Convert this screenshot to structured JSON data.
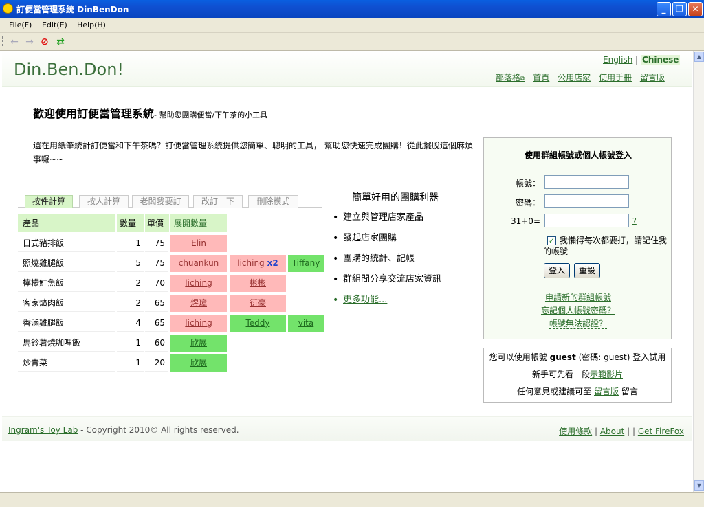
{
  "window": {
    "title": "訂便當管理系統 DinBenDon",
    "minimize": "_",
    "maximize": "❐",
    "close": "✕"
  },
  "menu": [
    "File(F)",
    "Edit(E)",
    "Help(H)"
  ],
  "toolbar": {
    "back_icon": "←",
    "forward_icon": "→",
    "stop_icon": "⊘",
    "refresh_icon": "⇄"
  },
  "header": {
    "logo": "Din.Ben.Don!",
    "lang_english": "English",
    "lang_sep": " | ",
    "lang_chinese": "Chinese",
    "nav": [
      "部落格",
      "首頁",
      "公用店家",
      "使用手冊",
      "留言版"
    ]
  },
  "welcome": {
    "title": "歡迎使用訂便當管理系統",
    "subtitle": "- 幫助您團購便當/下午茶的小工具"
  },
  "intro": "還在用紙筆統計訂便當和下午茶嗎？訂便當管理系統提供您簡單、聰明的工具， 幫助您快速完成團購！從此擺脫這個麻煩事囉~~",
  "tabs": [
    "按件計算",
    "按人計算",
    "老闆我要訂",
    "改訂一下",
    "刪除模式"
  ],
  "table": {
    "headers": {
      "product": "產品",
      "qty": "數量",
      "price": "單價",
      "expand": "展開數量"
    },
    "rows": [
      {
        "product": "日式豬排飯",
        "qty": "1",
        "price": "75",
        "chips": [
          {
            "name": "Elin",
            "color": "red"
          }
        ]
      },
      {
        "product": "照燒雞腿飯",
        "qty": "5",
        "price": "75",
        "chips": [
          {
            "name": "chuankun",
            "color": "red"
          },
          {
            "name": "liching",
            "mult": "x2",
            "color": "red"
          },
          {
            "name": "Tiffany",
            "color": "green"
          }
        ]
      },
      {
        "product": "檸檬鮭魚飯",
        "qty": "2",
        "price": "70",
        "chips": [
          {
            "name": "liching",
            "color": "red"
          },
          {
            "name": "彬彬",
            "color": "red"
          }
        ]
      },
      {
        "product": "客家爌肉飯",
        "qty": "2",
        "price": "65",
        "chips": [
          {
            "name": "煜璋",
            "color": "red"
          },
          {
            "name": "衍豪",
            "color": "red"
          }
        ]
      },
      {
        "product": "香滷雞腿飯",
        "qty": "4",
        "price": "65",
        "chips": [
          {
            "name": "liching",
            "color": "red"
          },
          {
            "name": "Teddy",
            "color": "green"
          },
          {
            "name": "vita",
            "color": "green"
          }
        ]
      },
      {
        "product": "馬鈴薯燒咖哩飯",
        "qty": "1",
        "price": "60",
        "chips": [
          {
            "name": "欣展",
            "color": "green"
          }
        ]
      },
      {
        "product": "炒青菜",
        "qty": "1",
        "price": "20",
        "chips": [
          {
            "name": "欣展",
            "color": "green"
          }
        ]
      }
    ]
  },
  "features": {
    "title": "簡單好用的團購利器",
    "items": [
      "建立與管理店家產品",
      "發起店家團購",
      "團購的統計、記帳",
      "群組間分享交流店家資訊"
    ],
    "more": "更多功能..."
  },
  "login": {
    "title": "使用群組帳號或個人帳號登入",
    "account_label": "帳號：",
    "password_label": "密碼：",
    "captcha_label": "31+0=",
    "captcha_help": "?",
    "remember": "我懶得每次都要打，請記住我的帳號",
    "login_button": "登入",
    "reset_button": "重設",
    "links": [
      "申請新的群組帳號",
      "忘記個人帳號密碼？",
      "帳號無法認證？"
    ]
  },
  "guest": {
    "line1_pre": "您可以使用帳號 ",
    "line1_user": "guest",
    "line1_post": " (密碼: guest) 登入試用",
    "line2_pre": "新手可先看一段",
    "line2_link": "示範影片",
    "line3_pre": "任何意見或建議可至 ",
    "line3_link": "留言版",
    "line3_post": " 留言"
  },
  "footer": {
    "lab": "Ingram's Toy Lab",
    "copyright": " - Copyright 2010© All rights reserved.",
    "links": [
      "使用條款",
      "About",
      "Get FireFox"
    ]
  }
}
